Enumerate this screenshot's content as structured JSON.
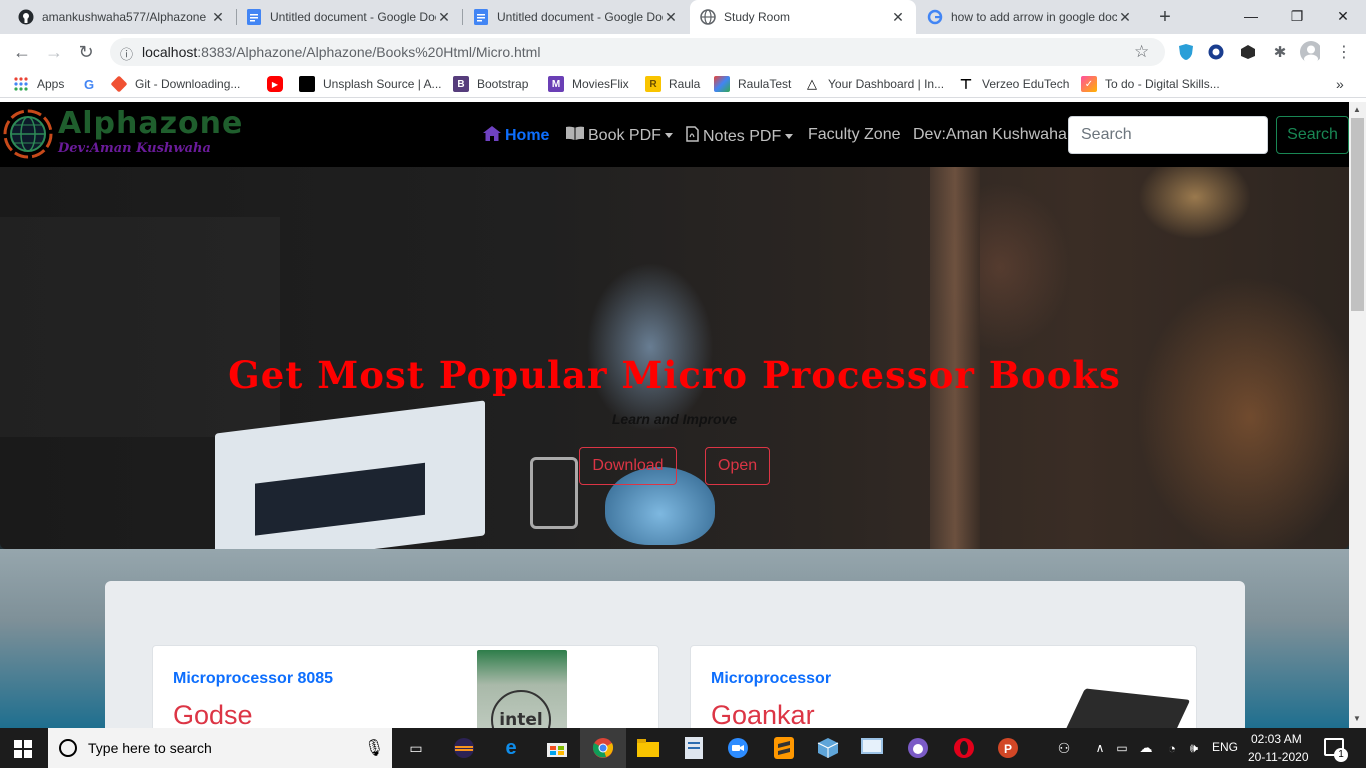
{
  "browser": {
    "tabs": [
      {
        "title": "amankushwaha577/Alphazone",
        "icon": "github-icon"
      },
      {
        "title": "Untitled document - Google Docs",
        "icon": "google-docs-icon"
      },
      {
        "title": "Untitled document - Google Docs",
        "icon": "google-docs-icon"
      },
      {
        "title": "Study Room",
        "icon": "globe-icon",
        "active": true
      },
      {
        "title": "how to add arrow in google docs",
        "icon": "google-icon"
      }
    ],
    "url_host": "localhost",
    "url_rest": ":8383/Alphazone/Alphazone/Books%20Html/Micro.html",
    "bookmarks": [
      {
        "label": "Apps",
        "icon": "apps-grid-icon"
      },
      {
        "label": "",
        "icon": "google-icon"
      },
      {
        "label": "Git - Downloading...",
        "icon": "git-icon"
      },
      {
        "label": "",
        "icon": "youtube-icon"
      },
      {
        "label": "Unsplash Source | A...",
        "icon": "unsplash-icon"
      },
      {
        "label": "Bootstrap",
        "icon": "bootstrap-icon"
      },
      {
        "label": "MoviesFlix",
        "icon": "moviesflix-icon"
      },
      {
        "label": "Raula",
        "icon": "folder-icon"
      },
      {
        "label": "RaulaTest",
        "icon": "raulatest-icon"
      },
      {
        "label": "Your Dashboard | In...",
        "icon": "dashboard-icon"
      },
      {
        "label": "Verzeo EduTech",
        "icon": "verzeo-icon"
      },
      {
        "label": "To do - Digital Skills...",
        "icon": "todo-icon"
      }
    ]
  },
  "site": {
    "logo_text": "Alphazone",
    "logo_sub": "Dev:Aman Kushwaha",
    "nav": {
      "home": "Home",
      "book_pdf": "Book PDF",
      "notes_pdf": "Notes PDF",
      "faculty_zone": "Faculty Zone",
      "dev": "Dev:Aman Kushwaha",
      "search_placeholder": "Search",
      "search_button": "Search"
    },
    "hero": {
      "title": "Get Most Popular Micro Processor Books",
      "subtitle": "Learn and Improve",
      "download_label": "Download",
      "open_label": "Open"
    },
    "cards": [
      {
        "title": "Microprocessor 8085",
        "author": "Godse",
        "image": "intel-chip-image"
      },
      {
        "title": "Microprocessor",
        "author": "Goankar",
        "image": "microchip-image"
      }
    ]
  },
  "taskbar": {
    "search_placeholder": "Type here to search",
    "language": "ENG",
    "time": "02:03 AM",
    "date": "20-11-2020",
    "notification_count": "1"
  },
  "colors": {
    "brand_green": "#1f5e2d",
    "hero_title": "#ff0000",
    "link_blue": "#0d6efd",
    "danger": "#dc3545",
    "success": "#198754"
  }
}
